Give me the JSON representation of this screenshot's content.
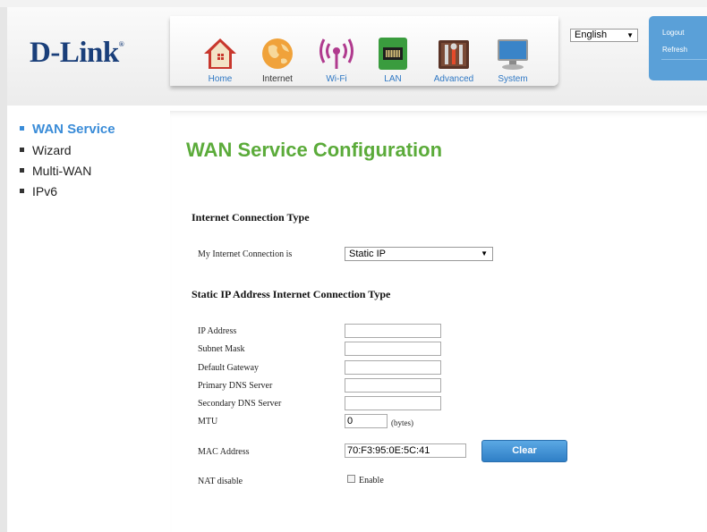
{
  "brand": {
    "logo": "D-Link",
    "reg": "®"
  },
  "nav": [
    {
      "label": "Home",
      "icon": "home-icon"
    },
    {
      "label": "Internet",
      "icon": "globe-icon"
    },
    {
      "label": "Wi-Fi",
      "icon": "wifi-icon"
    },
    {
      "label": "LAN",
      "icon": "lan-port-icon"
    },
    {
      "label": "Advanced",
      "icon": "tools-icon"
    },
    {
      "label": "System",
      "icon": "monitor-icon"
    }
  ],
  "active_nav": "Internet",
  "language": {
    "selected": "English"
  },
  "account": {
    "logout": "Logout",
    "refresh": "Refresh"
  },
  "sidebar": {
    "items": [
      {
        "label": "WAN Service",
        "active": true
      },
      {
        "label": "Wizard",
        "active": false
      },
      {
        "label": "Multi-WAN",
        "active": false
      },
      {
        "label": "IPv6",
        "active": false
      }
    ]
  },
  "page": {
    "title": "WAN Service Configuration",
    "section1": "Internet Connection Type",
    "connection_label": "My Internet Connection is",
    "connection_value": "Static IP",
    "section2": "Static IP Address Internet Connection Type",
    "fields": {
      "ip_label": "IP Address",
      "ip_value": "",
      "subnet_label": "Subnet Mask",
      "subnet_value": "",
      "gateway_label": "Default Gateway",
      "gateway_value": "",
      "dns1_label": "Primary DNS Server",
      "dns1_value": "",
      "dns2_label": "Secondary DNS Server",
      "dns2_value": "",
      "mtu_label": "MTU",
      "mtu_value": "0",
      "mtu_unit": "(bytes)",
      "mac_label": "MAC Address",
      "mac_value": "70:F3:95:0E:5C:41",
      "clear_label": "Clear",
      "nat_label": "NAT disable",
      "nat_enable_label": "Enable",
      "nat_checked": false
    }
  },
  "colors": {
    "title_green": "#5bab3a",
    "accent_blue": "#3a8cd8",
    "logo_navy": "#1a3f7a"
  }
}
